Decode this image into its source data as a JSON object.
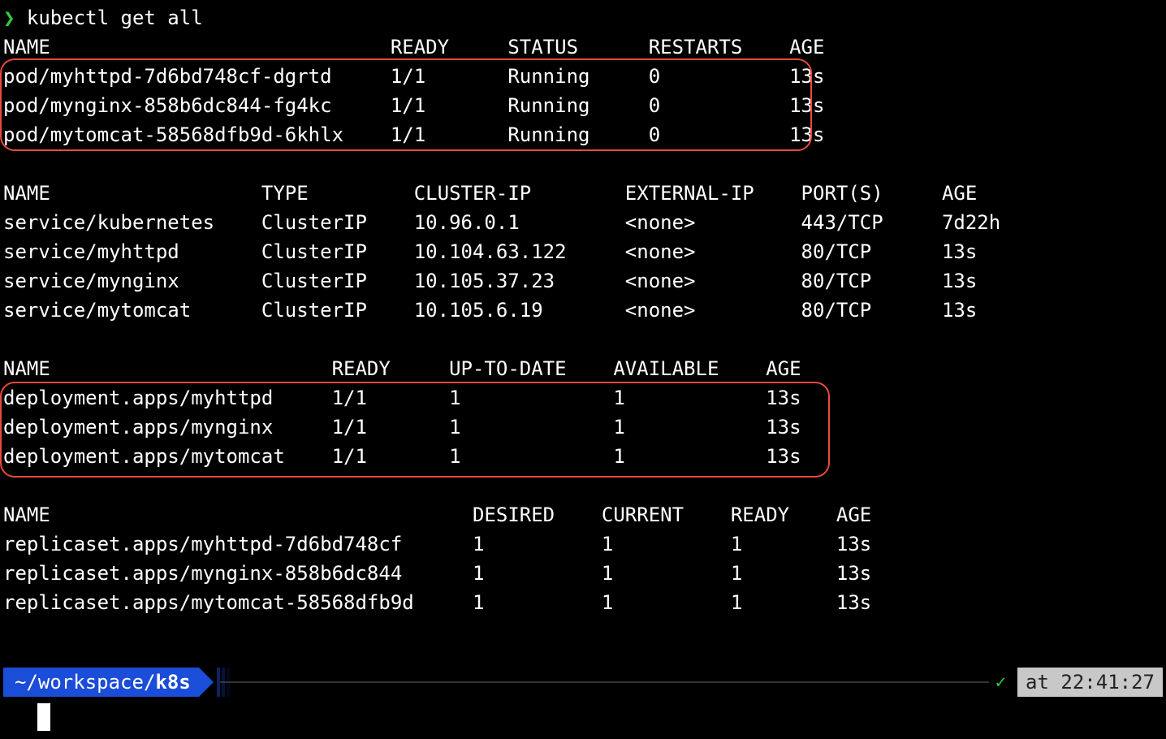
{
  "prompt": {
    "symbol": "❯",
    "command": "kubectl get all"
  },
  "pods": {
    "header": {
      "name": "NAME",
      "ready": "READY",
      "status": "STATUS",
      "restarts": "RESTARTS",
      "age": "AGE"
    },
    "rows": [
      {
        "name": "pod/myhttpd-7d6bd748cf-dgrtd",
        "ready": "1/1",
        "status": "Running",
        "restarts": "0",
        "age": "13s"
      },
      {
        "name": "pod/mynginx-858b6dc844-fg4kc",
        "ready": "1/1",
        "status": "Running",
        "restarts": "0",
        "age": "13s"
      },
      {
        "name": "pod/mytomcat-58568dfb9d-6khlx",
        "ready": "1/1",
        "status": "Running",
        "restarts": "0",
        "age": "13s"
      }
    ]
  },
  "services": {
    "header": {
      "name": "NAME",
      "type": "TYPE",
      "cip": "CLUSTER-IP",
      "eip": "EXTERNAL-IP",
      "ports": "PORT(S)",
      "age": "AGE"
    },
    "rows": [
      {
        "name": "service/kubernetes",
        "type": "ClusterIP",
        "cip": "10.96.0.1",
        "eip": "<none>",
        "ports": "443/TCP",
        "age": "7d22h"
      },
      {
        "name": "service/myhttpd",
        "type": "ClusterIP",
        "cip": "10.104.63.122",
        "eip": "<none>",
        "ports": "80/TCP",
        "age": "13s"
      },
      {
        "name": "service/mynginx",
        "type": "ClusterIP",
        "cip": "10.105.37.23",
        "eip": "<none>",
        "ports": "80/TCP",
        "age": "13s"
      },
      {
        "name": "service/mytomcat",
        "type": "ClusterIP",
        "cip": "10.105.6.19",
        "eip": "<none>",
        "ports": "80/TCP",
        "age": "13s"
      }
    ]
  },
  "deployments": {
    "header": {
      "name": "NAME",
      "ready": "READY",
      "utd": "UP-TO-DATE",
      "avail": "AVAILABLE",
      "age": "AGE"
    },
    "rows": [
      {
        "name": "deployment.apps/myhttpd",
        "ready": "1/1",
        "utd": "1",
        "avail": "1",
        "age": "13s"
      },
      {
        "name": "deployment.apps/mynginx",
        "ready": "1/1",
        "utd": "1",
        "avail": "1",
        "age": "13s"
      },
      {
        "name": "deployment.apps/mytomcat",
        "ready": "1/1",
        "utd": "1",
        "avail": "1",
        "age": "13s"
      }
    ]
  },
  "replicasets": {
    "header": {
      "name": "NAME",
      "desired": "DESIRED",
      "current": "CURRENT",
      "ready": "READY",
      "age": "AGE"
    },
    "rows": [
      {
        "name": "replicaset.apps/myhttpd-7d6bd748cf",
        "desired": "1",
        "current": "1",
        "ready": "1",
        "age": "13s"
      },
      {
        "name": "replicaset.apps/mynginx-858b6dc844",
        "desired": "1",
        "current": "1",
        "ready": "1",
        "age": "13s"
      },
      {
        "name": "replicaset.apps/mytomcat-58568dfb9d",
        "desired": "1",
        "current": "1",
        "ready": "1",
        "age": "13s"
      }
    ]
  },
  "status": {
    "cwd_prefix": "~/workspace/",
    "cwd_last": "k8s",
    "check": "✓",
    "time_prefix": "at ",
    "time": "22:41:27"
  },
  "widths": {
    "pods": [
      33,
      10,
      12,
      12,
      6
    ],
    "services": [
      22,
      13,
      18,
      15,
      12,
      8
    ],
    "deployments": [
      28,
      10,
      14,
      13,
      6
    ],
    "replicasets": [
      40,
      11,
      11,
      9,
      6
    ]
  }
}
